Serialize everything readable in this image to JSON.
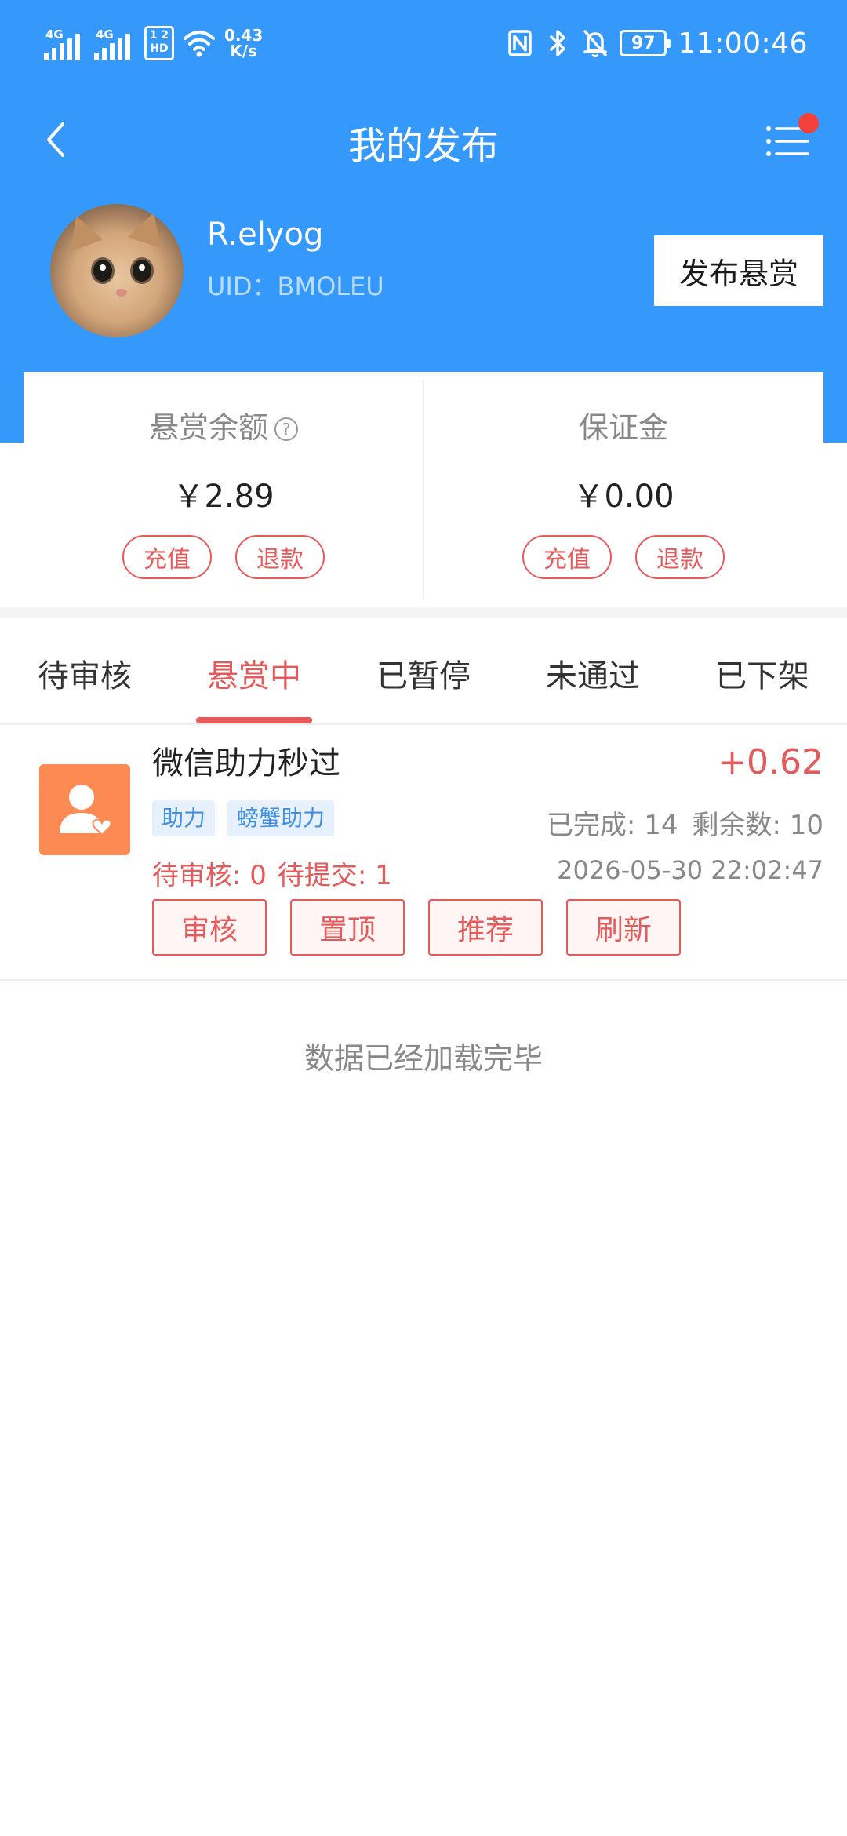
{
  "status_bar": {
    "network_1": "4G",
    "network_2": "4G",
    "hd_badge_top": "1 2",
    "hd_badge_bottom": "HD",
    "speed_value": "0.43",
    "speed_unit": "K/s",
    "battery": "97",
    "time": "11:00:46",
    "icons": [
      "signal-icon",
      "signal-icon",
      "hd-icon",
      "wifi-icon",
      "nfc-icon",
      "bluetooth-icon",
      "silent-bell-icon",
      "battery-icon"
    ]
  },
  "nav": {
    "title": "我的发布",
    "has_notification_dot": true
  },
  "profile": {
    "username": "R.elyog",
    "uid": "UID：BMOLEU",
    "publish_button": "发布悬赏"
  },
  "balance": {
    "reward": {
      "label": "悬赏余额",
      "help": "?",
      "value": "￥2.89",
      "recharge": "充值",
      "refund": "退款"
    },
    "deposit": {
      "label": "保证金",
      "value": "￥0.00",
      "recharge": "充值",
      "refund": "退款"
    }
  },
  "tabs": [
    {
      "label": "待审核",
      "active": false
    },
    {
      "label": "悬赏中",
      "active": true
    },
    {
      "label": "已暂停",
      "active": false
    },
    {
      "label": "未通过",
      "active": false
    },
    {
      "label": "已下架",
      "active": false
    }
  ],
  "tasks": [
    {
      "title": "微信助力秒过",
      "amount": "+0.62",
      "tags": [
        "助力",
        "螃蟹助力"
      ],
      "completed": "已完成: 14",
      "remaining": "剩余数: 10",
      "pending_review": "待审核: 0",
      "pending_submit": "待提交: 1",
      "time": "2026-05-30 22:02:47",
      "actions": [
        "审核",
        "置顶",
        "推荐",
        "刷新"
      ],
      "icon": "user-heart-icon"
    }
  ],
  "footer_text": "数据已经加载完毕",
  "colors": {
    "header_blue": "#3499fb",
    "accent_red": "#e55a5a",
    "task_icon_orange": "#fd8a52",
    "tag_blue": "#3f8fe6"
  }
}
